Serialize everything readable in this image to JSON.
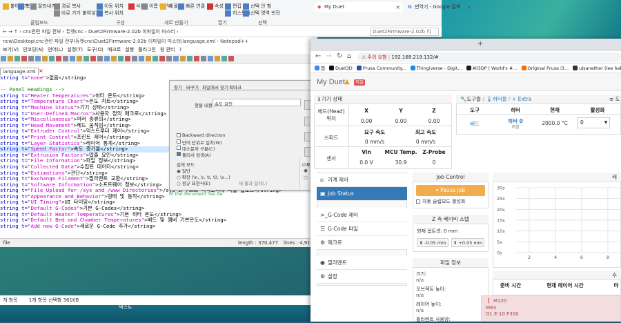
{
  "explorer": {
    "ribbon_items": [
      "붙여넣기",
      "복사",
      "잘라내기",
      "경로 복사",
      "바로 가기 붙여넣기",
      "이동 위치",
      "복사 위치",
      "삭제",
      "이름 바꾸기",
      "새 폴더",
      "빠른 연결",
      "속성",
      "편집",
      "히스토리",
      "선택 안 함",
      "선택 영역 반전"
    ],
    "groups": [
      "클립보드",
      "구성",
      "새로 만들기",
      "열기",
      "선택"
    ],
    "address": "cnc관련 파일 전부  ›  듀엣cnc  ›  Duet2Firmware-2.02b 이파일이 마스터  ›",
    "search_placeholder": "Duet2Firmware-2.02b 이파..."
  },
  "notepad": {
    "title": "ncw\\Desktop\\cnc관련 파일 전부\\듀엣cnc\\Duet2Firmware-2.02b 이파일이 마스터\\language.xml - Notepad++",
    "menu": [
      "보기(V)",
      "인코딩(N)",
      "언어(L)",
      "설정(T)",
      "도구(O)",
      "매크로",
      "실행",
      "플러그인",
      "창 관리",
      "?"
    ],
    "tab": "language.xml",
    "lines": [
      [
        "string t=",
        "\"none\"",
        ">없음</string>"
      ],
      [
        "",
        "",
        ""
      ],
      [
        "c",
        "-- Panel Headings -->",
        ""
      ],
      [
        "string t=",
        "\"Heater Temperatures\"",
        ">히터 온도</string>"
      ],
      [
        "string t=",
        "\"Temperature Chart\"",
        ">온도 차트</string>"
      ],
      [
        "string t=",
        "\"Machine Status\"",
        ">기기 상태</string>"
      ],
      [
        "string t=",
        "\"User-Defined Macros\"",
        ">사용자 정의 매크로</string>"
      ],
      [
        "string t=",
        "\"Miscellaneous\"",
        ">여러 종류의</string>"
      ],
      [
        "string t=",
        "\"Head Movement\"",
        ">헤드 움직임</string>"
      ],
      [
        "string t=",
        "\"Extruder Control\"",
        ">익스트루더 제어</string>"
      ],
      [
        "string t=",
        "\"Print Control\"",
        ">프린트 제어</string>"
      ],
      [
        "string t=",
        "\"Layer Statistics\"",
        ">레이어 통계</string>"
      ],
      [
        "string t=",
        "\"Speed Factor\"",
        ">속도 증가율</string>"
      ],
      [
        "string t=",
        "\"Extrusion Factors\"",
        ">압출 요인</string>"
      ],
      [
        "string t=",
        "\"File Information\"",
        ">파일 정보</string>"
      ],
      [
        "string t=",
        "\"Collected Data\"",
        ">수집된 데이터</string>"
      ],
      [
        "string t=",
        "\"Estimations\"",
        ">관단</string>"
      ],
      [
        "string t=",
        "\"Exchange Filament\"",
        ">필라멘트 교환</string>"
      ],
      [
        "string t=",
        "\"Software Information\"",
        ">소프트웨어 정보</string>"
      ],
      [
        "string t=",
        "\"File Upload for /sys and /www Directories\"",
        ">/sys 와 /www 디렉토리에 파일 업로드</string>"
      ],
      [
        "string t=",
        "\"Appearance and Behavior\"",
        ">형태 및 동작</string>"
      ],
      [
        "string t=",
        "\"UI Timing\"",
        ">UI 타이밍</string>"
      ],
      [
        "string t=",
        "\"Default G-Codes\"",
        ">기본 G-Codes</string>"
      ],
      [
        "string t=",
        "\"Default Heater Temperatures\"",
        ">기본 히터 온도</string>"
      ],
      [
        "string t=",
        "\"Default Bed and Chamber Temperatures\"",
        ">배드 및 챔버 기본온도</string>"
      ],
      [
        "string t=",
        "\"Add new G-Code\"",
        ">새로운 G-Code 추가</string>"
      ]
    ],
    "status_left": "file",
    "status_length": "length : 370,477",
    "status_lines": "lines : 4,911",
    "find_tail": "of the document has be"
  },
  "find_dialog": {
    "tabs": [
      "찾기",
      "바꾸기",
      "파일에서 찾기",
      "북마크"
    ],
    "find_label": "찾을 내용 :",
    "find_value": "속도 요인",
    "options": [
      "Backward direction",
      "단어 단위로 일치(W)",
      "대소문자 구분(C)",
      "둘러서 검색(A)"
    ],
    "mode_title": "검색 모드",
    "modes": [
      "일반",
      "확장 (\\n, \\r, \\t, \\0, \\x...)",
      "정규 표현식(E)"
    ],
    "mode_extra": "새 줄과 일치(.)",
    "transparency": "투명"
  },
  "taskbar": {
    "selection": "1개 항목 선택함 361KB",
    "count": "개 항목",
    "desktop_label": "텍스트"
  },
  "browser": {
    "tabs": [
      {
        "title": "My Duet",
        "active": true
      },
      {
        "title": "번역기 - Google 검색",
        "active": false
      }
    ],
    "new_tab": "+",
    "url_warning": "주의 요함",
    "url": "192.168.219.132/#",
    "bookmarks": [
      "앱",
      "Duet3D",
      "Prusa Community...",
      "Thingiverse - Digit...",
      "All3DP | World's #...",
      "Original Prusa i3...",
      "ulsanether (lee hak..."
    ],
    "bookmark_colors": [
      "#4285f4",
      "#111111",
      "#2b5797",
      "#1e88e5",
      "#1c1c1c",
      "#ff6b00",
      "#333333"
    ]
  },
  "duet": {
    "title": "My Duet",
    "badge": "꺼짐",
    "machine_status": {
      "header": "기기 상태",
      "head_label": "헤드(Head) 위치",
      "axes": [
        "X",
        "Y",
        "Z"
      ],
      "axis_values": [
        "0.00",
        "0.00",
        "0.00"
      ],
      "speed_label": "스피드",
      "req_speed_label": "요구 속도",
      "top_speed_label": "최고 속도",
      "req_speed": "0 mm/s",
      "top_speed": "0 mm/s",
      "sensor_label": "센서",
      "sensor_cols": [
        "Vin",
        "MCU Temp.",
        "Z-Probe"
      ],
      "sensor_values": [
        "0.0 V",
        "30.9",
        "0"
      ]
    },
    "tools": {
      "header_tools": "도구들",
      "header_heaters": "히터들",
      "header_extra": "Extra",
      "header_right": "도",
      "cols": [
        "도구",
        "히터",
        "현재",
        "활성화"
      ],
      "row_tool": "베드",
      "row_heater": "히터 0",
      "row_heater_state": "꺼짐",
      "row_current": "2000.0 °C",
      "row_active": "0"
    },
    "nav": [
      {
        "label": "기계 제어",
        "icon": "home-icon"
      },
      {
        "label": "Job Status",
        "icon": "print-icon"
      },
      {
        "label": "G-Code 제어",
        "icon": "terminal-icon"
      },
      {
        "label": "G-Code 파일",
        "icon": "file-icon"
      },
      {
        "label": "매크로",
        "icon": "link-icon"
      },
      {
        "label": "필라멘트",
        "icon": "filament-icon"
      },
      {
        "label": "설정",
        "icon": "gear-icon"
      }
    ],
    "job_control": {
      "header": "Job Control",
      "pause": "Pause Job",
      "autosleep": "자동 슬립모드 활성화"
    },
    "baby": {
      "header": "Z 축 베이비 스텝",
      "offset": "현재 옵트셋: 0 mm",
      "minus": "-0.05 mm",
      "plus": "+0.05 mm"
    },
    "file_info": {
      "header": "파일 정보",
      "rows": [
        {
          "label": "크기:",
          "value": "n/a"
        },
        {
          "label": "오브젝트 높이:",
          "value": "n/a"
        },
        {
          "label": "레이어 높이:",
          "value": "n/a"
        },
        {
          "label": "필라멘트 사용양:",
          "value": ""
        }
      ]
    },
    "chart_header": "레",
    "stats_header": "수",
    "stats_cols": [
      "준비 시간",
      "현재 레이어 시간",
      "마"
    ],
    "alert": [
      "M120",
      "M83",
      "G1 E-10 F300"
    ]
  },
  "chart_data": {
    "type": "line",
    "x_ticks": [
      "2",
      "4",
      "6",
      "8"
    ],
    "y_ticks": [
      "30s",
      "25s",
      "20s",
      "15s",
      "10s",
      "5s",
      "0s"
    ],
    "xlim": [
      1,
      8.9
    ],
    "ylim": [
      0,
      30
    ],
    "grid": true,
    "series": []
  }
}
